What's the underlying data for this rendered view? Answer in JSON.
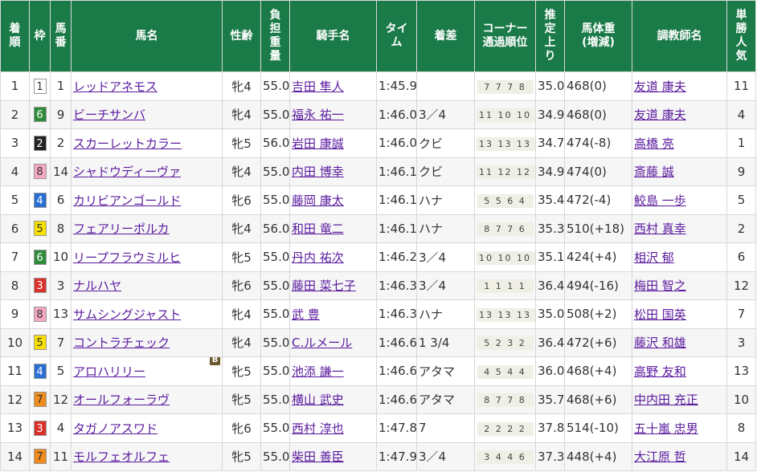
{
  "headers": {
    "rank": [
      "着",
      "順"
    ],
    "waku": [
      "枠"
    ],
    "umaban": [
      "馬",
      "番"
    ],
    "horse": "馬名",
    "sexage": "性齢",
    "weight": [
      "負",
      "担",
      "重",
      "量"
    ],
    "jockey": "騎手名",
    "time": [
      "タイ",
      "ム"
    ],
    "margin": "着差",
    "corner": [
      "コーナー",
      "通過順位"
    ],
    "last3f": [
      "推",
      "定",
      "上",
      "り"
    ],
    "bodyweight": [
      "馬体重",
      "(増減)"
    ],
    "trainer": "調教師名",
    "popularity": [
      "単",
      "勝",
      "人",
      "気"
    ]
  },
  "rows": [
    {
      "rank": "1",
      "waku": "1",
      "waku_bg": "#ffffff",
      "waku_fg": "#333333",
      "umaban": "1",
      "horse": "レッドアネモス",
      "blinker": "",
      "sexage": "牝4",
      "weight": "55.0",
      "jockey": "吉田 隼人",
      "time": "1:45.9",
      "margin": "",
      "corner": "7 7 7 8",
      "last3f": "35.0",
      "bodyweight": "468(0)",
      "trainer": "友道 康夫",
      "pop": "11"
    },
    {
      "rank": "2",
      "waku": "6",
      "waku_bg": "#2e8b3a",
      "waku_fg": "#ffffff",
      "umaban": "9",
      "horse": "ビーチサンバ",
      "blinker": "",
      "sexage": "牝4",
      "weight": "55.0",
      "jockey": "福永 祐一",
      "time": "1:46.0",
      "margin": "3／4",
      "corner": "11 10 10 11",
      "last3f": "34.9",
      "bodyweight": "468(0)",
      "trainer": "友道 康夫",
      "pop": "4"
    },
    {
      "rank": "3",
      "waku": "2",
      "waku_bg": "#222222",
      "waku_fg": "#ffffff",
      "umaban": "2",
      "horse": "スカーレットカラー",
      "blinker": "",
      "sexage": "牝5",
      "weight": "56.0",
      "jockey": "岩田 康誠",
      "time": "1:46.0",
      "margin": "クビ",
      "corner": "13 13 13 11",
      "last3f": "34.7",
      "bodyweight": "474(-8)",
      "trainer": "高橋 亮",
      "pop": "1"
    },
    {
      "rank": "4",
      "waku": "8",
      "waku_bg": "#f5a7c4",
      "waku_fg": "#333333",
      "umaban": "14",
      "horse": "シャドウディーヴァ",
      "blinker": "",
      "sexage": "牝4",
      "weight": "55.0",
      "jockey": "内田 博幸",
      "time": "1:46.1",
      "margin": "クビ",
      "corner": "11 12 12 8",
      "last3f": "34.9",
      "bodyweight": "474(0)",
      "trainer": "斎藤 誠",
      "pop": "9"
    },
    {
      "rank": "5",
      "waku": "4",
      "waku_bg": "#2a6fd1",
      "waku_fg": "#ffffff",
      "umaban": "6",
      "horse": "カリビアンゴールド",
      "blinker": "",
      "sexage": "牝6",
      "weight": "55.0",
      "jockey": "藤岡 康太",
      "time": "1:46.1",
      "margin": "ハナ",
      "corner": "5 5 6 4",
      "last3f": "35.4",
      "bodyweight": "472(-4)",
      "trainer": "鮫島 一歩",
      "pop": "5"
    },
    {
      "rank": "6",
      "waku": "5",
      "waku_bg": "#f7e000",
      "waku_fg": "#333333",
      "umaban": "8",
      "horse": "フェアリーポルカ",
      "blinker": "",
      "sexage": "牝4",
      "weight": "56.0",
      "jockey": "和田 竜二",
      "time": "1:46.1",
      "margin": "ハナ",
      "corner": "8 7 7 6",
      "last3f": "35.3",
      "bodyweight": "510(+18)",
      "trainer": "西村 真幸",
      "pop": "2"
    },
    {
      "rank": "7",
      "waku": "6",
      "waku_bg": "#2e8b3a",
      "waku_fg": "#ffffff",
      "umaban": "10",
      "horse": "リープフラウミルヒ",
      "blinker": "",
      "sexage": "牝5",
      "weight": "55.0",
      "jockey": "丹内 祐次",
      "time": "1:46.2",
      "margin": "3／4",
      "corner": "10 10 10 11",
      "last3f": "35.1",
      "bodyweight": "424(+4)",
      "trainer": "相沢 郁",
      "pop": "6"
    },
    {
      "rank": "8",
      "waku": "3",
      "waku_bg": "#d9302a",
      "waku_fg": "#ffffff",
      "umaban": "3",
      "horse": "ナルハヤ",
      "blinker": "",
      "sexage": "牝6",
      "weight": "55.0",
      "jockey": "藤田 菜七子",
      "time": "1:46.3",
      "margin": "3／4",
      "corner": "1 1 1 1",
      "last3f": "36.4",
      "bodyweight": "494(-16)",
      "trainer": "梅田 智之",
      "pop": "12"
    },
    {
      "rank": "9",
      "waku": "8",
      "waku_bg": "#f5a7c4",
      "waku_fg": "#333333",
      "umaban": "13",
      "horse": "サムシングジャスト",
      "blinker": "",
      "sexage": "牝4",
      "weight": "55.0",
      "jockey": "武 豊",
      "time": "1:46.3",
      "margin": "ハナ",
      "corner": "13 13 13 14",
      "last3f": "35.0",
      "bodyweight": "508(+2)",
      "trainer": "松田 国英",
      "pop": "7"
    },
    {
      "rank": "10",
      "waku": "5",
      "waku_bg": "#f7e000",
      "waku_fg": "#333333",
      "umaban": "7",
      "horse": "コントラチェック",
      "blinker": "",
      "sexage": "牝4",
      "weight": "55.0",
      "jockey": "C.ルメール",
      "time": "1:46.6",
      "margin": "1 3/4",
      "corner": "5 2 3 2",
      "last3f": "36.4",
      "bodyweight": "472(+6)",
      "trainer": "藤沢 和雄",
      "pop": "3"
    },
    {
      "rank": "11",
      "waku": "4",
      "waku_bg": "#2a6fd1",
      "waku_fg": "#ffffff",
      "umaban": "5",
      "horse": "アロハリリー",
      "blinker": "B",
      "sexage": "牝5",
      "weight": "55.0",
      "jockey": "池添 謙一",
      "time": "1:46.6",
      "margin": "アタマ",
      "corner": "4 5 4 4",
      "last3f": "36.0",
      "bodyweight": "468(+4)",
      "trainer": "高野 友和",
      "pop": "13"
    },
    {
      "rank": "12",
      "waku": "7",
      "waku_bg": "#f08c1e",
      "waku_fg": "#333333",
      "umaban": "12",
      "horse": "オールフォーラヴ",
      "blinker": "",
      "sexage": "牝5",
      "weight": "55.0",
      "jockey": "横山 武史",
      "time": "1:46.6",
      "margin": "アタマ",
      "corner": "8 7 7 8",
      "last3f": "35.7",
      "bodyweight": "468(+6)",
      "trainer": "中内田 充正",
      "pop": "10"
    },
    {
      "rank": "13",
      "waku": "3",
      "waku_bg": "#d9302a",
      "waku_fg": "#ffffff",
      "umaban": "4",
      "horse": "タガノアスワド",
      "blinker": "",
      "sexage": "牝6",
      "weight": "55.0",
      "jockey": "西村 淳也",
      "time": "1:47.8",
      "margin": "7",
      "corner": "2 2 2 2",
      "last3f": "37.8",
      "bodyweight": "514(-10)",
      "trainer": "五十嵐 忠男",
      "pop": "8"
    },
    {
      "rank": "14",
      "waku": "7",
      "waku_bg": "#f08c1e",
      "waku_fg": "#333333",
      "umaban": "11",
      "horse": "モルフェオルフェ",
      "blinker": "",
      "sexage": "牝5",
      "weight": "55.0",
      "jockey": "柴田 善臣",
      "time": "1:47.9",
      "margin": "3／4",
      "corner": "3 4 4 6",
      "last3f": "37.3",
      "bodyweight": "448(+4)",
      "trainer": "大江原 哲",
      "pop": "14"
    }
  ]
}
